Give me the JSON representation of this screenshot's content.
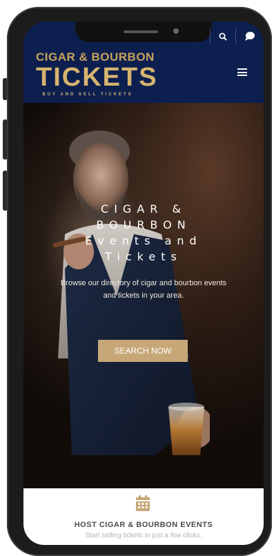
{
  "colors": {
    "header_bg": "#0c1f4f",
    "gold": "#c9a35d",
    "button_bg": "#c7a777",
    "card_title": "#4a4a4a",
    "card_sub": "#b3b3b3"
  },
  "icons": {
    "search": "search-icon",
    "chat": "chat-bubble-icon",
    "menu": "hamburger-menu-icon",
    "calendar": "calendar-icon"
  },
  "logo": {
    "top": "CIGAR & BOURBON",
    "main": "TICKETS",
    "tagline": "BUY AND SELL TICKETS"
  },
  "hero": {
    "title": "CIGAR & BOURBON Events and Tickets",
    "description": "Browse our directory of cigar and bourbon events and tickets in your area.",
    "button_label": "SEARCH NOW"
  },
  "feature_card": {
    "title": "HOST CIGAR & BOURBON EVENTS",
    "subtitle": "Start selling tickets in just a few clicks."
  }
}
